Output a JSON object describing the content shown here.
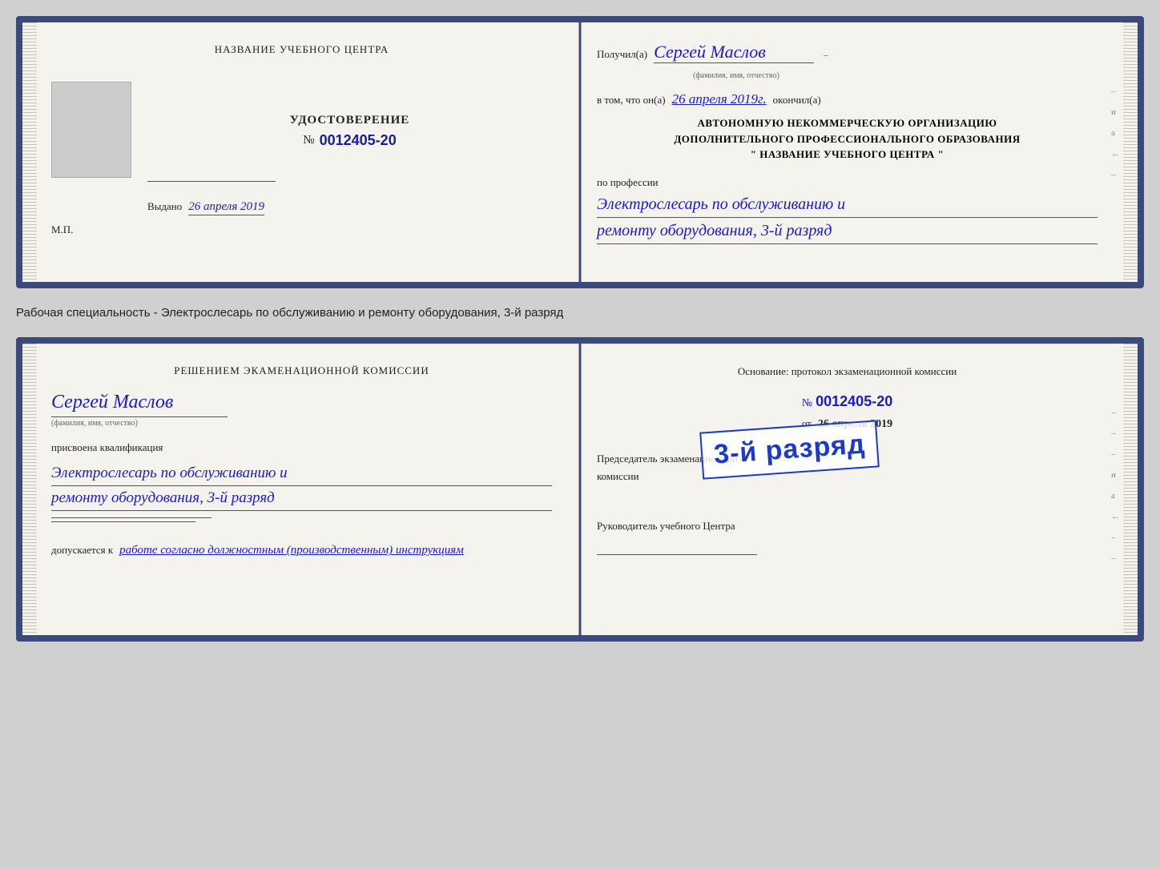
{
  "doc1": {
    "left": {
      "training_center_label": "НАЗВАНИЕ УЧЕБНОГО ЦЕНТРА",
      "udost_label": "УДОСТОВЕРЕНИЕ",
      "number_prefix": "№",
      "number": "0012405-20",
      "vydano_prefix": "Выдано",
      "vydano_date": "26 апреля 2019",
      "mp_label": "М.П."
    },
    "right": {
      "received_prefix": "Получил(а)",
      "received_name": "Сергей Маслов",
      "fio_label": "(фамилия, имя, отчество)",
      "dash": "–",
      "in_that_prefix": "в том, что он(а)",
      "in_that_date": "26 апреля 2019г.",
      "finished_label": "окончил(а)",
      "org_line1": "АВТОНОМНУЮ НЕКОММЕРЧЕСКУЮ ОРГАНИЗАЦИЮ",
      "org_line2": "ДОПОЛНИТЕЛЬНОГО ПРОФЕССИОНАЛЬНОГО ОБРАЗОВАНИЯ",
      "org_quote1": "\"",
      "org_name": "НАЗВАНИЕ УЧЕБНОГО ЦЕНТРА",
      "org_quote2": "\"",
      "profession_prefix": "по профессии",
      "profession_line1": "Электрослесарь по обслуживанию и",
      "profession_line2": "ремонту оборудования, 3-й разряд"
    }
  },
  "between_label": "Рабочая специальность - Электрослесарь по обслуживанию и ремонту оборудования, 3-й разряд",
  "doc2": {
    "left": {
      "decision_label": "Решением экаменационной комиссии",
      "person_name": "Сергей Маслов",
      "fio_label": "(фамилия, имя, отчество)",
      "qualification_prefix": "присвоена квалификация",
      "qual_line1": "Электрослесарь по обслуживанию и",
      "qual_line2": "ремонту оборудования, 3-й разряд",
      "admitted_prefix": "допускается к",
      "admitted_text": "работе согласно должностным (производственным) инструкциям"
    },
    "right": {
      "basis_label": "Основание: протокол экзаменационной комиссии",
      "number_prefix": "№",
      "number": "0012405-20",
      "date_prefix": "от",
      "date": "26 апреля 2019",
      "chairman_label": "Председатель экзаменационной комиссии",
      "stamp_text": "3-й разряд",
      "head_label": "Руководитель учебного Центра"
    }
  },
  "right_margin": {
    "chars": [
      "и",
      "а",
      "←",
      "–",
      "–",
      "–"
    ]
  }
}
